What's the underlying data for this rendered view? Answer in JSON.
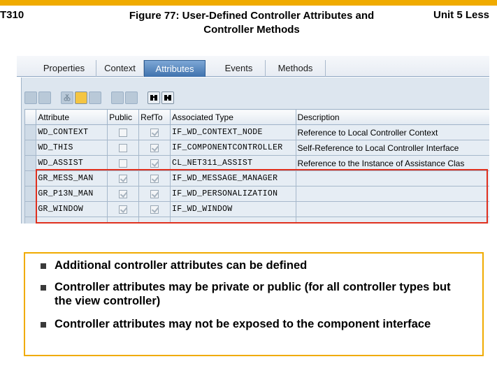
{
  "header": {
    "left": "T310",
    "title_line1": "Figure 77: User-Defined Controller Attributes and",
    "title_line2": "Controller Methods",
    "right": "Unit 5 Less"
  },
  "colors": {
    "accent_bar": "#f0ab00",
    "highlight_border": "#e0301e",
    "active_tab": "#3f72ad"
  },
  "tabs": [
    {
      "label": "Properties",
      "active": false
    },
    {
      "label": "Context",
      "active": false
    },
    {
      "label": "Attributes",
      "active": true
    },
    {
      "label": "Events",
      "active": false
    },
    {
      "label": "Methods",
      "active": false
    }
  ],
  "toolbar": {
    "icons": [
      "insert-row-icon",
      "delete-row-icon",
      "cut-icon",
      "copy-icon",
      "paste-icon",
      "details-icon",
      "print-icon",
      "find-icon",
      "find-next-icon"
    ]
  },
  "table": {
    "columns": [
      "Attribute",
      "Public",
      "RefTo",
      "Associated Type",
      "Description"
    ],
    "rows": [
      {
        "attribute": "WD_CONTEXT",
        "public": false,
        "refto": true,
        "type": "IF_WD_CONTEXT_NODE",
        "description": "Reference to Local Controller Context"
      },
      {
        "attribute": "WD_THIS",
        "public": false,
        "refto": true,
        "type": "IF_COMPONENTCONTROLLER",
        "description": "Self-Reference to Local Controller Interface"
      },
      {
        "attribute": "WD_ASSIST",
        "public": false,
        "refto": true,
        "type": "CL_NET311_ASSIST",
        "description": "Reference to the Instance of Assistance Clas"
      },
      {
        "attribute": "GR_MESS_MAN",
        "public": true,
        "refto": true,
        "type": "IF_WD_MESSAGE_MANAGER",
        "description": ""
      },
      {
        "attribute": "GR_P13N_MAN",
        "public": true,
        "refto": true,
        "type": "IF_WD_PERSONALIZATION",
        "description": ""
      },
      {
        "attribute": "GR_WINDOW",
        "public": true,
        "refto": true,
        "type": "IF_WD_WINDOW",
        "description": ""
      }
    ]
  },
  "bullets": [
    "Additional controller attributes can be defined",
    "Controller attributes may be private or public (for all controller types but the view controller)",
    "Controller attributes may not be exposed to the component interface"
  ]
}
